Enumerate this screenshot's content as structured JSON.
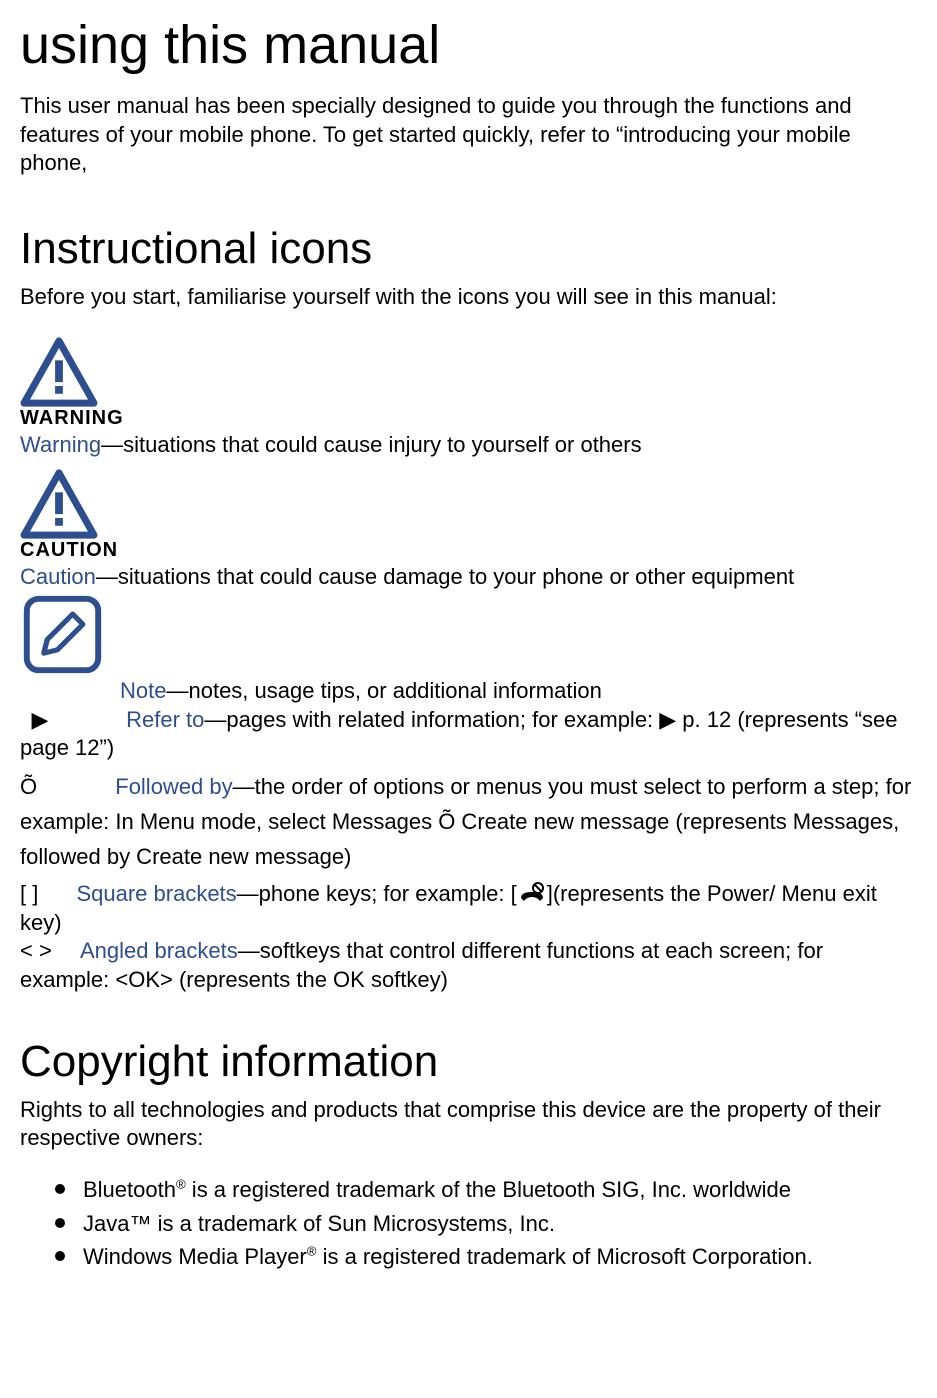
{
  "top_title": "using this manual",
  "top_intro": "This user manual has been specially designed to guide you through the functions and features of your mobile phone. To get started quickly, refer to “introducing your mobile phone,",
  "heading_icons": "Instructional icons",
  "icons_intro": "Before you start, familiarise yourself with the icons you will see in this manual:",
  "warning": {
    "label": "WARNING",
    "keyword": "Warning",
    "text": "—situations that could cause injury to yourself or others"
  },
  "caution": {
    "label": "CAUTION",
    "keyword": "Caution",
    "text": "—situations that could cause damage to your phone or other equipment"
  },
  "note": {
    "keyword": "Note",
    "text": "—notes, usage tips, or additional information"
  },
  "refer": {
    "symbol": "▶",
    "keyword": "Refer to",
    "text": "—pages with related information; for example: ▶ p. 12 (represents “see page 12”)"
  },
  "followed": {
    "symbol": "Õ",
    "keyword": "Followed by",
    "text": "—the order of options or menus you must select to perform a step; for example: In Menu mode, select Messages Õ Create new message (represents Messages, followed by Create new message)"
  },
  "square": {
    "symbol": "[    ]",
    "keyword": "Square brackets",
    "text_pre": "—phone keys; for example: [",
    "text_post": "](represents the Power/ Menu exit key)"
  },
  "angled": {
    "symbol": "<    >",
    "keyword": "Angled brackets",
    "text": "—softkeys that control different functions at each screen; for example: <OK> (represents the OK softkey)"
  },
  "heading_copyright": "Copyright information",
  "copyright_intro": "Rights to all technologies and products that comprise this device are the property of their respective owners:",
  "bullets": {
    "0": {
      "pre": "Bluetooth",
      "sup": "®",
      "post": " is a registered trademark of the Bluetooth SIG, Inc. worldwide"
    },
    "1": {
      "text": "Java™ is a trademark of Sun Microsystems, Inc."
    },
    "2": {
      "pre": "Windows Media Player",
      "sup": "®",
      "post": " is a registered trademark of Microsoft Corporation."
    }
  }
}
